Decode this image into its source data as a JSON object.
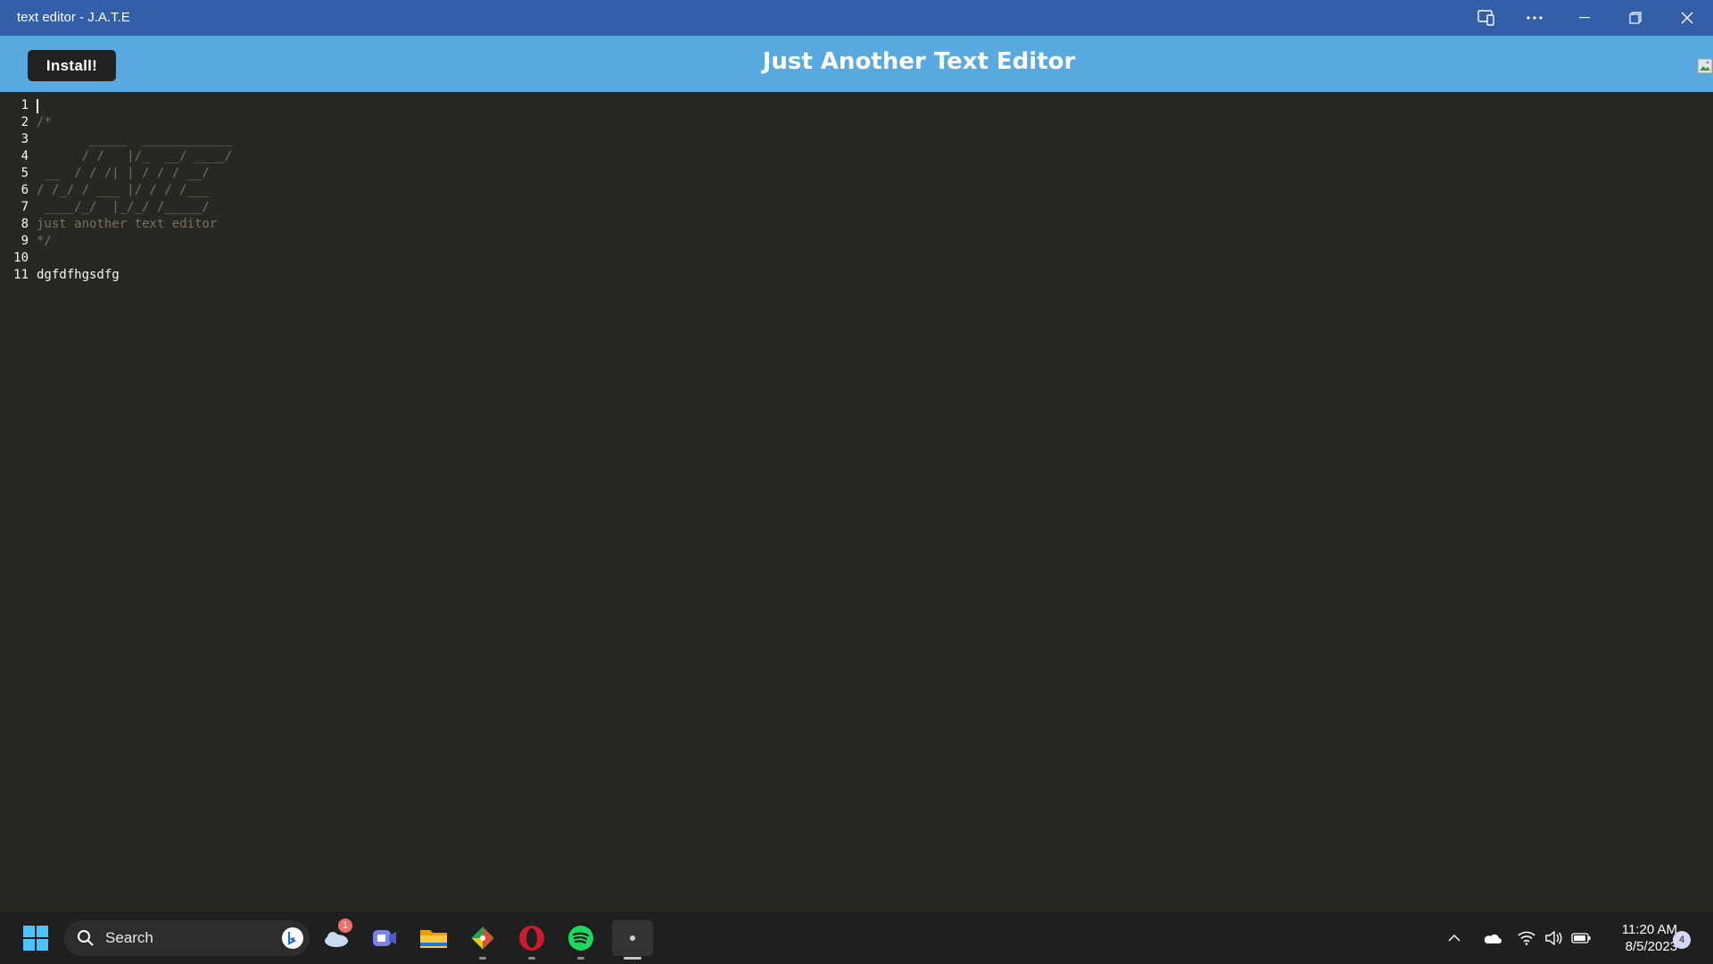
{
  "window": {
    "title": "text editor - J.A.T.E"
  },
  "header": {
    "install_label": "Install!",
    "title": "Just Another Text Editor"
  },
  "editor": {
    "lines": [
      {
        "n": "1",
        "text": "",
        "kind": "normal"
      },
      {
        "n": "2",
        "text": "/*",
        "kind": "comment"
      },
      {
        "n": "3",
        "text": "       _____  ____________",
        "kind": "comment"
      },
      {
        "n": "4",
        "text": "      / /   |/_  __/ ____/",
        "kind": "comment"
      },
      {
        "n": "5",
        "text": " __  / / /| | / / / __/",
        "kind": "comment"
      },
      {
        "n": "6",
        "text": "/ /_/ / ___ |/ / / /___",
        "kind": "comment"
      },
      {
        "n": "7",
        "text": " ____/_/  |_/_/ /_____/",
        "kind": "comment"
      },
      {
        "n": "8",
        "text": "just another text editor",
        "kind": "comment"
      },
      {
        "n": "9",
        "text": "*/",
        "kind": "comment"
      },
      {
        "n": "10",
        "text": "",
        "kind": "normal"
      },
      {
        "n": "11",
        "text": "dgfdfhgsdfg",
        "kind": "normal"
      }
    ]
  },
  "taskbar": {
    "search_label": "Search",
    "weather_badge": "1",
    "time": "11:20 AM",
    "date": "8/5/2023",
    "notifications": "4"
  },
  "colors": {
    "titlebar": "#335ea8",
    "appbar": "#58a9e0",
    "editor_bg": "#272822",
    "comment": "#75715e"
  }
}
